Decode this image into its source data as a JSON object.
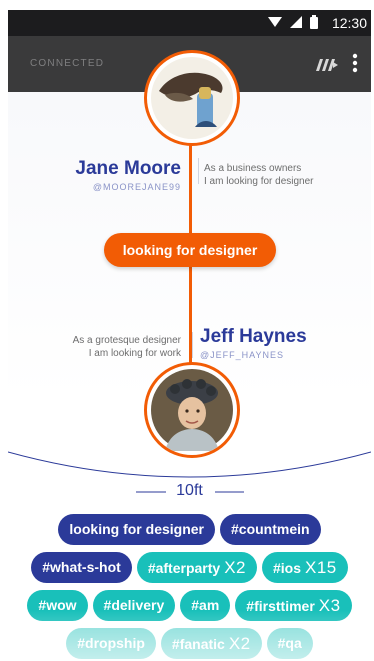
{
  "status_bar": {
    "time": "12:30"
  },
  "app_bar": {
    "status": "CONNECTED"
  },
  "users": [
    {
      "name": "Jane Moore",
      "handle": "@MOOREJANE99",
      "bio_line1": "As a business owners",
      "bio_line2": "I am looking for designer"
    },
    {
      "name": "Jeff Haynes",
      "handle": "@JEFF_HAYNES",
      "bio_line1": "As a grotesque designer",
      "bio_line2": "I am looking for work"
    }
  ],
  "match": {
    "label": "looking for designer"
  },
  "distance": "10ft",
  "tags": [
    [
      {
        "label": "looking for designer",
        "multiplier": "",
        "color": "#2b3a99"
      },
      {
        "label": "#countmein",
        "multiplier": "",
        "color": "#2b3a99"
      }
    ],
    [
      {
        "label": "#what-s-hot",
        "multiplier": "",
        "color": "#2b3a99"
      },
      {
        "label": "#afterparty",
        "multiplier": "X2",
        "color": "#19c0ba"
      },
      {
        "label": "#ios",
        "multiplier": "X15",
        "color": "#19c0ba"
      }
    ],
    [
      {
        "label": "#wow",
        "multiplier": "",
        "color": "#19c0ba"
      },
      {
        "label": "#delivery",
        "multiplier": "",
        "color": "#19c0ba"
      },
      {
        "label": "#am",
        "multiplier": "",
        "color": "#19c0ba"
      },
      {
        "label": "#firsttimer",
        "multiplier": "X3",
        "color": "#19c0ba"
      }
    ],
    [
      {
        "label": "#dropship",
        "multiplier": "",
        "color": "#19c0ba"
      },
      {
        "label": "#fanatic",
        "multiplier": "X2",
        "color": "#19c0ba"
      },
      {
        "label": "#qa",
        "multiplier": "",
        "color": "#19c0ba"
      }
    ]
  ],
  "colors": {
    "accent": "#f25c05",
    "navy": "#2b3a99",
    "teal": "#19c0ba"
  }
}
